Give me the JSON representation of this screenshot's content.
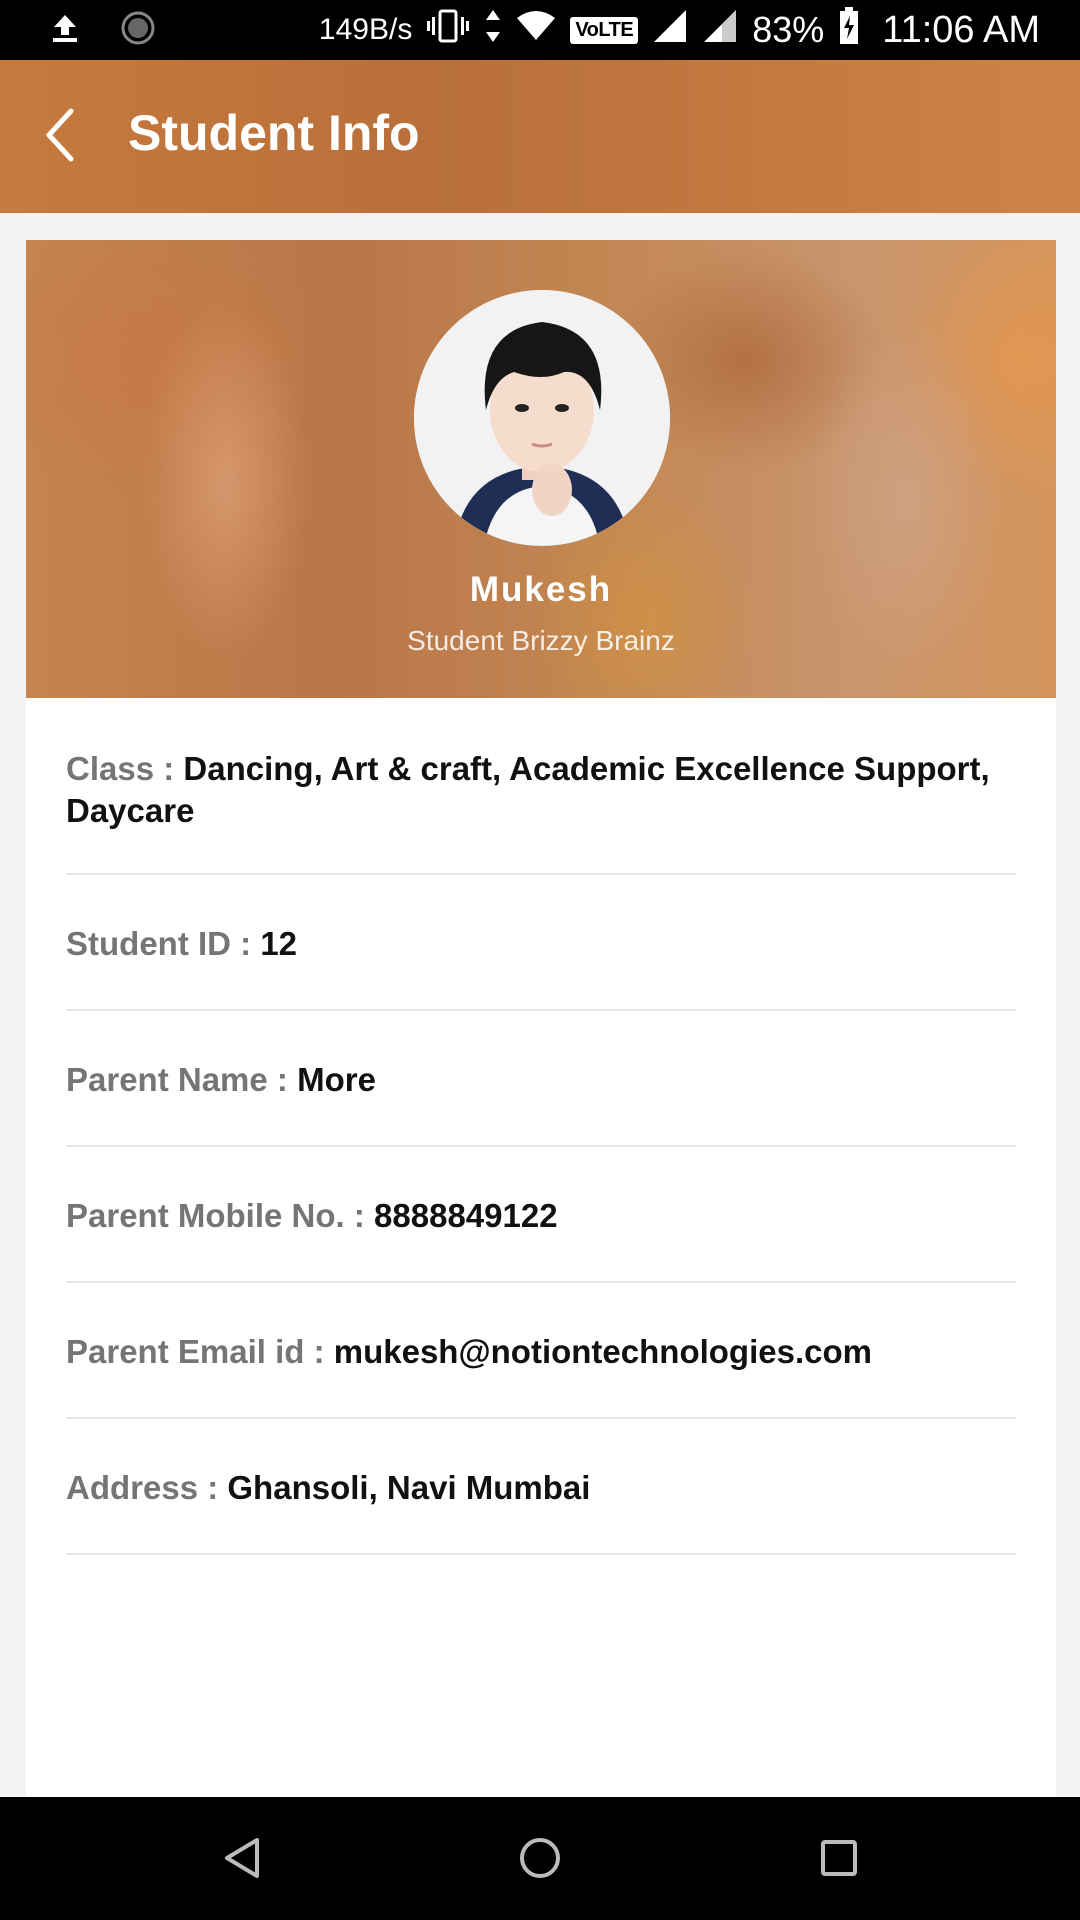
{
  "status_bar": {
    "net_speed": "149B/s",
    "volte": "VoLTE",
    "battery": "83%",
    "time": "11:06 AM"
  },
  "app_bar": {
    "title": "Student Info",
    "back_icon": "chevron-left-icon"
  },
  "profile": {
    "name": "Mukesh",
    "subtitle": "Student Brizzy Brainz"
  },
  "info": {
    "class_label": "Class :",
    "class_value": "Dancing, Art & craft, Academic Excellence Support, Daycare",
    "student_id_label": "Student ID :",
    "student_id_value": "12",
    "parent_name_label": "Parent Name :",
    "parent_name_value": "More",
    "parent_mobile_label": "Parent Mobile No. :",
    "parent_mobile_value": "8888849122",
    "parent_email_label": "Parent Email id :",
    "parent_email_value": "mukesh@notiontechnologies.com",
    "address_label": "Address :",
    "address_value": "Ghansoli, Navi Mumbai"
  },
  "colors": {
    "app_bar": "#c77a3d",
    "label": "#757575",
    "value": "#111111"
  }
}
